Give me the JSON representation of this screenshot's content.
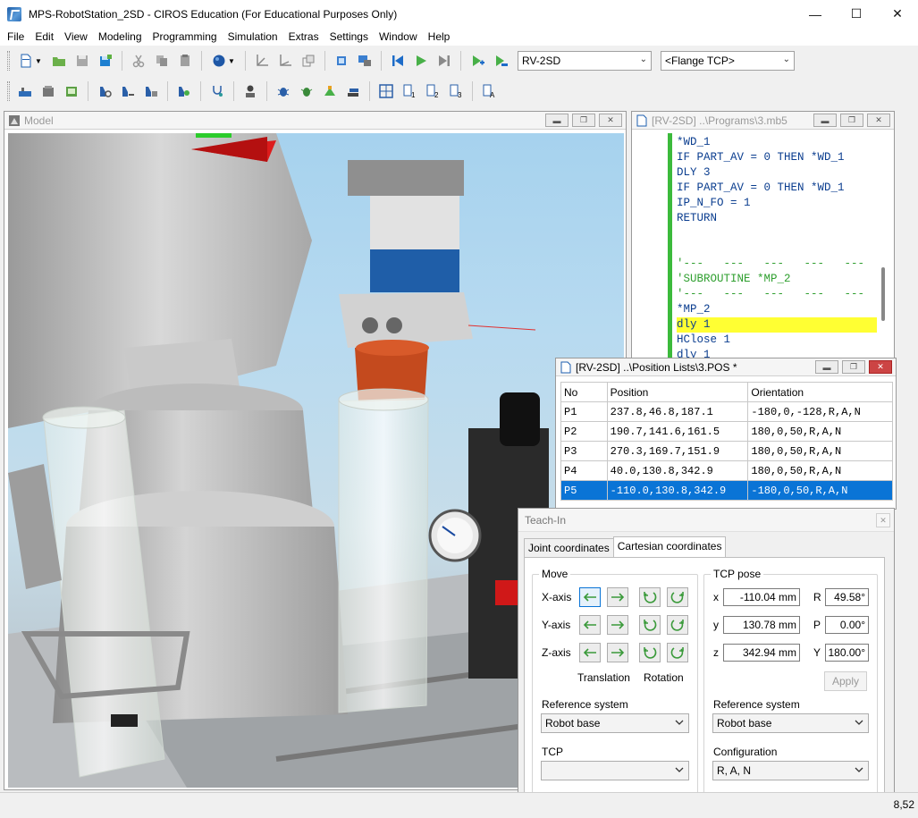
{
  "window": {
    "title": "MPS-RobotStation_2SD - CIROS Education (For Educational Purposes Only)",
    "minimize": "—",
    "maximize": "☐",
    "close": "✕"
  },
  "menu": [
    "File",
    "Edit",
    "View",
    "Modeling",
    "Programming",
    "Simulation",
    "Extras",
    "Settings",
    "Window",
    "Help"
  ],
  "toolbar": {
    "robot_select": "RV-2SD",
    "tcp_select": "<Flange TCP>"
  },
  "model_view": {
    "title": "Model"
  },
  "program_editor": {
    "title": "[RV-2SD] ..\\Programs\\3.mb5",
    "lines": [
      {
        "text": "*WD_1",
        "type": "code"
      },
      {
        "text": "IF PART_AV = 0 THEN *WD_1",
        "type": "code"
      },
      {
        "text": "DLY 3",
        "type": "code"
      },
      {
        "text": "IF PART_AV = 0 THEN *WD_1",
        "type": "code"
      },
      {
        "text": "IP_N_FO = 1",
        "type": "code"
      },
      {
        "text": "RETURN",
        "type": "code"
      },
      {
        "text": "",
        "type": "code"
      },
      {
        "text": "",
        "type": "code"
      },
      {
        "text": "'---   ---   ---   ---   ---",
        "type": "comment"
      },
      {
        "text": "'SUBROUTINE *MP_2",
        "type": "comment"
      },
      {
        "text": "'---   ---   ---   ---   ---",
        "type": "comment"
      },
      {
        "text": "*MP_2",
        "type": "code"
      },
      {
        "text": "dly 1",
        "type": "highlight"
      },
      {
        "text": "HClose 1",
        "type": "code"
      },
      {
        "text": "dly 1",
        "type": "code"
      }
    ]
  },
  "position_list": {
    "title": "[RV-2SD] ..\\Position Lists\\3.POS *",
    "headers": [
      "No",
      "Position",
      "Orientation"
    ],
    "rows": [
      {
        "no": "P1",
        "position": "237.8,46.8,187.1",
        "orientation": "-180,0,-128,R,A,N"
      },
      {
        "no": "P2",
        "position": "190.7,141.6,161.5",
        "orientation": "180,0,50,R,A,N"
      },
      {
        "no": "P3",
        "position": "270.3,169.7,151.9",
        "orientation": "180,0,50,R,A,N"
      },
      {
        "no": "P4",
        "position": "40.0,130.8,342.9",
        "orientation": "180,0,50,R,A,N"
      },
      {
        "no": "P5",
        "position": "-110.0,130.8,342.9",
        "orientation": "-180,0,50,R,A,N"
      }
    ],
    "selected_row": "P5"
  },
  "teach_in": {
    "title": "Teach-In",
    "close": "✕",
    "tabs": [
      "Joint coordinates",
      "Cartesian coordinates"
    ],
    "active_tab": "Cartesian coordinates",
    "move": {
      "label": "Move",
      "axes": [
        "X-axis",
        "Y-axis",
        "Z-axis"
      ],
      "translation_label": "Translation",
      "rotation_label": "Rotation"
    },
    "tcp_pose": {
      "label": "TCP pose",
      "x_label": "x",
      "x": "-110.04 mm",
      "y_label": "y",
      "y": "130.78 mm",
      "z_label": "z",
      "z": "342.94 mm",
      "r_label": "R",
      "r": "49.58°",
      "p_label": "P",
      "p": "0.00°",
      "yaw_label": "Y",
      "yaw": "180.00°",
      "apply": "Apply"
    },
    "left_reference_label": "Reference system",
    "left_reference_value": "Robot base",
    "tcp_label": "TCP",
    "tcp_value": "",
    "right_reference_label": "Reference system",
    "right_reference_value": "Robot base",
    "configuration_label": "Configuration",
    "configuration_value": "R, A, N"
  },
  "statusbar": {
    "coord": "8,52"
  },
  "colors": {
    "selection": "#0a74d6",
    "code_keyword": "#0a3d8f",
    "code_comment": "#2f9f2f",
    "highlight": "#ffff33",
    "gutter": "#3cba3c"
  }
}
